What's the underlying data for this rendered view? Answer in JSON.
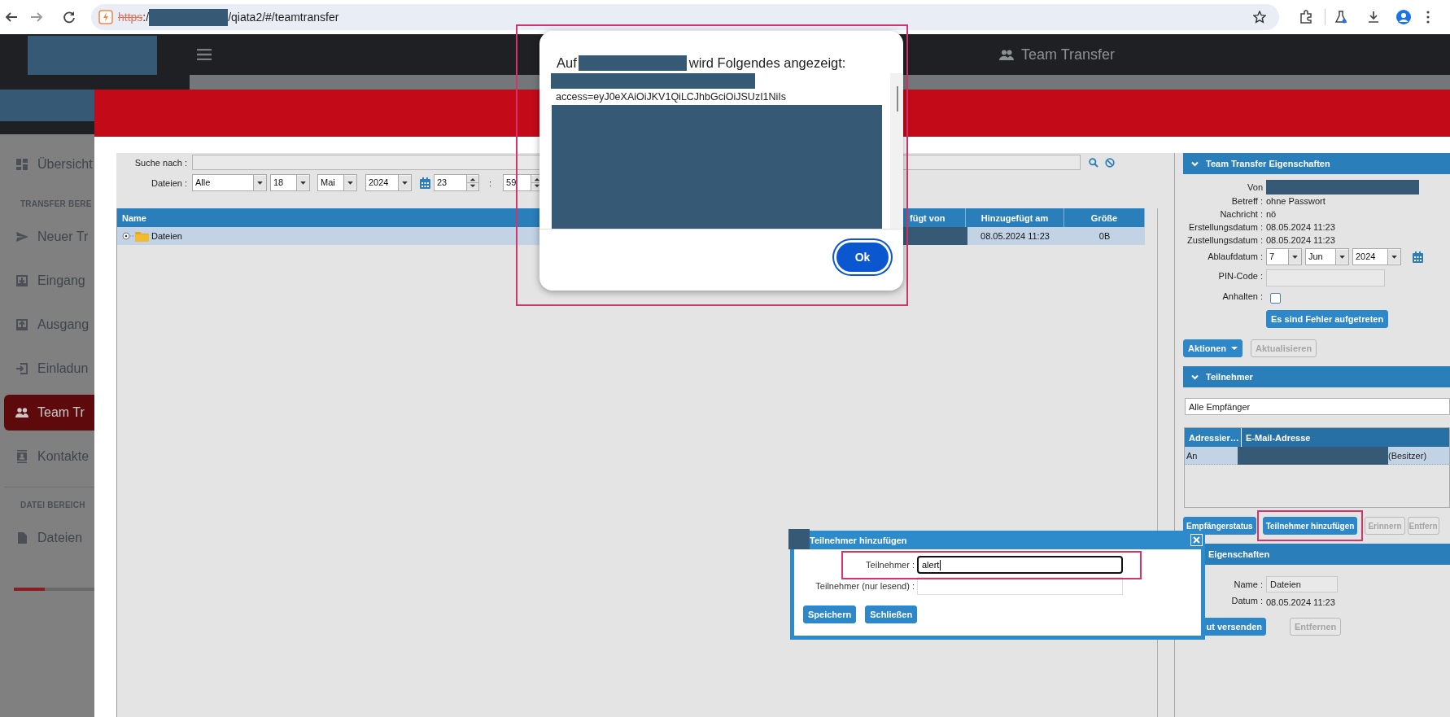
{
  "browser": {
    "url": {
      "scheme": "https",
      "insecure": true,
      "separator": ":/",
      "host_redacted": true,
      "path": "/qiata2/#/teamtransfer"
    }
  },
  "app_header": {
    "logo_redacted": true,
    "title": "Team Transfer"
  },
  "sidebar": {
    "account_redacted": true,
    "sections": [
      {
        "items": [
          {
            "label": "Übersicht",
            "selected": false
          }
        ]
      },
      {
        "heading": "TRANSFER BERE",
        "items": [
          {
            "label": "Neuer Tr",
            "selected": false
          },
          {
            "label": "Eingang",
            "selected": false
          },
          {
            "label": "Ausgang",
            "selected": false
          },
          {
            "label": "Einladun",
            "selected": false
          },
          {
            "label": "Team Tr",
            "selected": true
          },
          {
            "label": "Kontakte",
            "selected": false
          }
        ]
      },
      {
        "heading": "DATEI BEREICH",
        "items": [
          {
            "label": "Dateien",
            "selected": false
          }
        ]
      }
    ],
    "storage": {
      "level": 0.38
    }
  },
  "search": {
    "label": "Suche nach :"
  },
  "file_filter": {
    "label": "Dateien :",
    "scope": "Alle",
    "day": "18",
    "month": "Mai",
    "year": "2024",
    "hour": "23",
    "separator": ":",
    "minute": "59"
  },
  "files_table": {
    "columns": [
      {
        "label": "Name"
      },
      {
        "label": "fügt von"
      },
      {
        "label": "Hinzugefügt am"
      },
      {
        "label": "Größe"
      }
    ],
    "rows": [
      {
        "name": "Dateien",
        "selected": true,
        "added_by_redacted": true,
        "added_at": "08.05.2024 11:23",
        "size": "0B"
      }
    ]
  },
  "transfer_properties": {
    "title": "Team Transfer Eigenschaften",
    "expanded": true,
    "fields": [
      {
        "kind": "redacted",
        "label": "Von"
      },
      {
        "kind": "text",
        "label": "Betreff :",
        "value": "ohne Passwort"
      },
      {
        "kind": "text",
        "label": "Nachricht :",
        "value": "nö"
      },
      {
        "kind": "text",
        "label": "Erstellungsdatum :",
        "value": "08.05.2024 11:23"
      },
      {
        "kind": "text",
        "label": "Zustellungsdatum :",
        "value": "08.05.2024 11:23"
      },
      {
        "kind": "date",
        "label": "Ablaufdatum :",
        "day": "7",
        "month": "Jun",
        "year": "2024"
      },
      {
        "kind": "input",
        "label": "PIN-Code :"
      },
      {
        "kind": "checkbox",
        "label": "Anhalten :",
        "checked": false
      },
      {
        "kind": "button",
        "label": "Es sind Fehler aufgetreten"
      }
    ],
    "actions": [
      {
        "kind": "menu",
        "label": "Aktionen",
        "disabled": false
      },
      {
        "kind": "button",
        "label": "Aktualisieren",
        "disabled": true
      }
    ]
  },
  "participants": {
    "title": "Teilnehmer",
    "expanded": true,
    "filter": "Alle Empfänger",
    "columns": [
      {
        "label": "Adressier…"
      },
      {
        "label": "E-Mail-Adresse"
      }
    ],
    "rows": [
      {
        "type": "An",
        "email_redacted": true,
        "note": "(Besitzer)",
        "selected": true
      }
    ],
    "buttons": [
      {
        "label": "Empfängerstatus",
        "disabled": false,
        "highlighted": false
      },
      {
        "label": "Teilnehmer hinzufügen",
        "disabled": false,
        "highlighted": true
      },
      {
        "label": "Erinnern",
        "disabled": true,
        "highlighted": false
      },
      {
        "label": "Entfern",
        "disabled": true,
        "highlighted": false
      }
    ]
  },
  "file_properties": {
    "title": "Eigenschaften",
    "fields": [
      {
        "kind": "input",
        "label": "Name :",
        "value": "Dateien"
      },
      {
        "kind": "text",
        "label": "Datum :",
        "value": "08.05.2024 11:23"
      }
    ],
    "buttons": [
      {
        "label": "ut versenden",
        "disabled": false
      },
      {
        "label": "Entfernen",
        "disabled": true
      }
    ]
  },
  "alert_dialog": {
    "title_before": "Auf",
    "host_redacted": true,
    "title_after": "wird Folgendes angezeigt:",
    "message": "access=eyJ0eXAiOiJKV1QiLCJhbGciOiJSUzI1NiIs",
    "ok_button": "Ok",
    "highlighted": true
  },
  "add_participant_dialog": {
    "title": "Teilnehmer hinzufügen",
    "icon_redacted": true,
    "fields": [
      {
        "label": "Teilnehmer :",
        "value": "alert",
        "focused": true,
        "highlighted": true
      },
      {
        "label": "Teilnehmer (nur lesend) :",
        "focused": false,
        "highlighted": false
      }
    ],
    "buttons": [
      {
        "label": "Speichern"
      },
      {
        "label": "Schließen"
      }
    ]
  }
}
